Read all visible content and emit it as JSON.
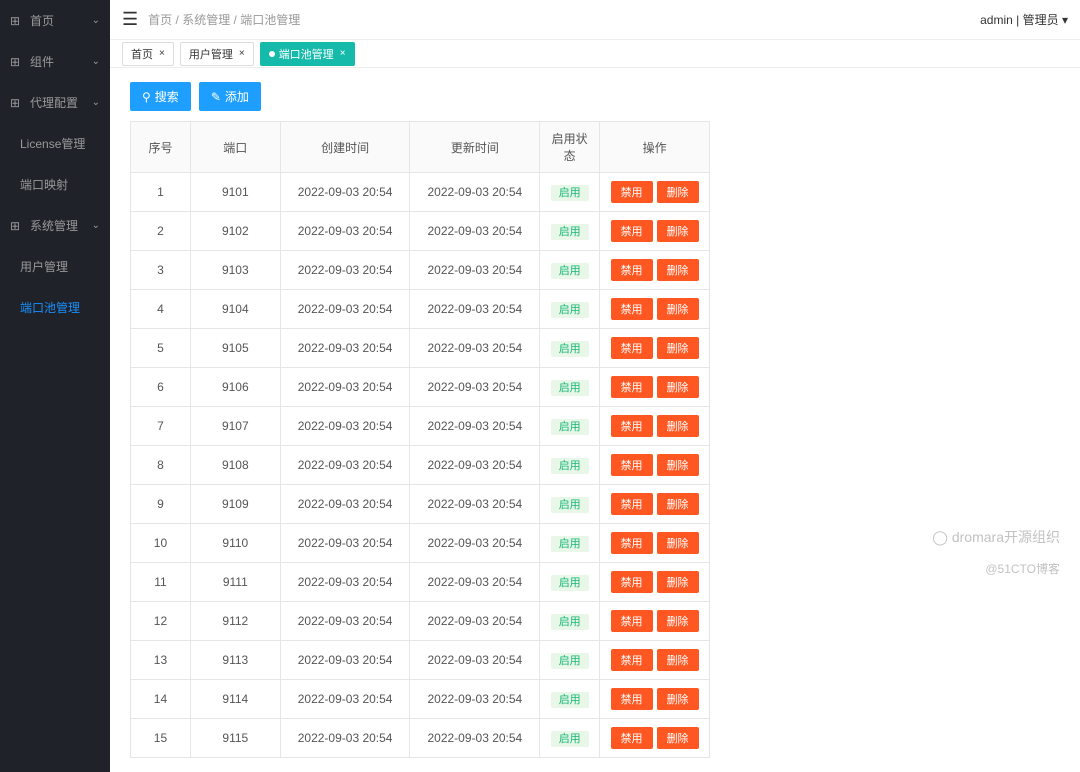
{
  "sidebar": {
    "items": [
      {
        "label": "首页",
        "icon": "⊞"
      },
      {
        "label": "组件",
        "icon": "⊞"
      },
      {
        "label": "代理配置",
        "icon": "⊞"
      },
      {
        "label": "License管理",
        "sub": true
      },
      {
        "label": "端口映射",
        "sub": true
      },
      {
        "label": "系统管理",
        "icon": "⊞"
      },
      {
        "label": "用户管理",
        "sub": true
      },
      {
        "label": "端口池管理",
        "sub": true,
        "active": true
      }
    ]
  },
  "breadcrumb": {
    "home": "首页",
    "sep": "/",
    "l1": "系统管理",
    "l2": "端口池管理"
  },
  "user": {
    "name": "admin",
    "role": "管理员"
  },
  "tabs": [
    {
      "label": "首页"
    },
    {
      "label": "用户管理"
    },
    {
      "label": "端口池管理",
      "active": true
    }
  ],
  "toolbar": {
    "search": "搜索",
    "add": "添加"
  },
  "columns": [
    "序号",
    "端口",
    "创建时间",
    "更新时间",
    "启用状态",
    "操作"
  ],
  "status_label": "启用",
  "disable_label": "禁用",
  "delete_label": "删除",
  "rows": [
    {
      "seq": "1",
      "port": "9101",
      "created": "2022-09-03 20:54",
      "updated": "2022-09-03 20:54"
    },
    {
      "seq": "2",
      "port": "9102",
      "created": "2022-09-03 20:54",
      "updated": "2022-09-03 20:54"
    },
    {
      "seq": "3",
      "port": "9103",
      "created": "2022-09-03 20:54",
      "updated": "2022-09-03 20:54"
    },
    {
      "seq": "4",
      "port": "9104",
      "created": "2022-09-03 20:54",
      "updated": "2022-09-03 20:54"
    },
    {
      "seq": "5",
      "port": "9105",
      "created": "2022-09-03 20:54",
      "updated": "2022-09-03 20:54"
    },
    {
      "seq": "6",
      "port": "9106",
      "created": "2022-09-03 20:54",
      "updated": "2022-09-03 20:54"
    },
    {
      "seq": "7",
      "port": "9107",
      "created": "2022-09-03 20:54",
      "updated": "2022-09-03 20:54"
    },
    {
      "seq": "8",
      "port": "9108",
      "created": "2022-09-03 20:54",
      "updated": "2022-09-03 20:54"
    },
    {
      "seq": "9",
      "port": "9109",
      "created": "2022-09-03 20:54",
      "updated": "2022-09-03 20:54"
    },
    {
      "seq": "10",
      "port": "9110",
      "created": "2022-09-03 20:54",
      "updated": "2022-09-03 20:54"
    },
    {
      "seq": "11",
      "port": "9111",
      "created": "2022-09-03 20:54",
      "updated": "2022-09-03 20:54"
    },
    {
      "seq": "12",
      "port": "9112",
      "created": "2022-09-03 20:54",
      "updated": "2022-09-03 20:54"
    },
    {
      "seq": "13",
      "port": "9113",
      "created": "2022-09-03 20:54",
      "updated": "2022-09-03 20:54"
    },
    {
      "seq": "14",
      "port": "9114",
      "created": "2022-09-03 20:54",
      "updated": "2022-09-03 20:54"
    },
    {
      "seq": "15",
      "port": "9115",
      "created": "2022-09-03 20:54",
      "updated": "2022-09-03 20:54"
    }
  ],
  "watermark": {
    "brand": "dromara开源组织",
    "attribution": "@51CTO博客"
  }
}
